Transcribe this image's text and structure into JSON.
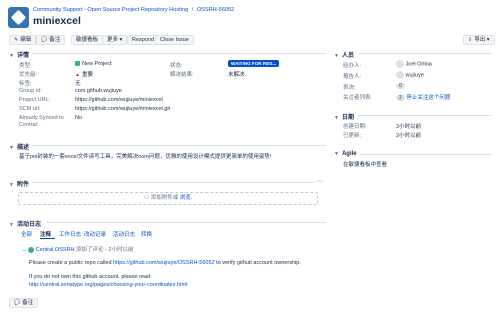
{
  "header": {
    "breadcrumb_1": "Community Support - Open Source Project Repository Hosting",
    "breadcrumb_sep": "/",
    "breadcrumb_2": "OSSRH-56052",
    "title": "miniexcel"
  },
  "toolbar": {
    "edit": "编辑",
    "comment": "备注",
    "dashboard": "敏捷看板",
    "more": "更多",
    "respond": "Respond",
    "close": "Close Issue",
    "export": "导出"
  },
  "details": {
    "heading": "详情",
    "type_label": "类型:",
    "type_value": "New Project",
    "priority_label": "优先级:",
    "priority_value": "重要",
    "tags_label": "标签:",
    "tags_value": "无",
    "group_label": "Group Id:",
    "group_value": "com.github.wujiuye",
    "url_label": "Project URL:",
    "url_value": "https://github.com/wujiuye/miniexcel",
    "scm_label": "SCM url:",
    "scm_value": "https://github.com/wujiuye/miniexcel.git",
    "synced_label": "Already Synced to Central:",
    "synced_value": "No",
    "status_label": "状态:",
    "status_value": "WAITING FOR RES...",
    "resolution_label": "解决结果:",
    "resolution_value": "未解决"
  },
  "description": {
    "heading": "描述",
    "text": "基于poi封装的一套excel文件读写工具，完美解决oom问题，优雅的使用设计模式提供更简单的使用姿势!"
  },
  "attachments": {
    "heading": "附件",
    "drop_text": "添加附件或",
    "browse": "浏览."
  },
  "activity": {
    "heading": "活动日志",
    "tabs": [
      "全部",
      "注释",
      "工作日志",
      "改动记录",
      "活动日志",
      "转换"
    ],
    "comment_author": "Central OSSRH",
    "comment_meta": "添加了评论 - 2小时以前",
    "comment_line1_prefix": "Please create a public repo called",
    "comment_line1_link": "https://github.com/wujiuye/OSSRH-56052",
    "comment_line1_suffix": "to verify github account ownership.",
    "comment_line2": "If you do not own this github account, please read:",
    "comment_link2": "http://central.sonatype.org/pages/choosing-your-coordinates.html",
    "bottom_comment": "备注"
  },
  "people": {
    "heading": "人员",
    "assignee_label": "经办人:",
    "assignee_value": "Joel Orlina",
    "reporter_label": "报告人:",
    "reporter_value": "wujiuye",
    "votes_label": "表决:",
    "votes_value": "0",
    "watchers_label": "关注者列表:",
    "watchers_count": "2",
    "watchers_link": "停止关注这个问题"
  },
  "dates": {
    "heading": "日期",
    "created_label": "创建日期:",
    "created_value": "2小时以前",
    "updated_label": "已更新:",
    "updated_value": "2小时以前"
  },
  "agile": {
    "heading": "Agile",
    "link": "在敏捷看板中查看"
  }
}
